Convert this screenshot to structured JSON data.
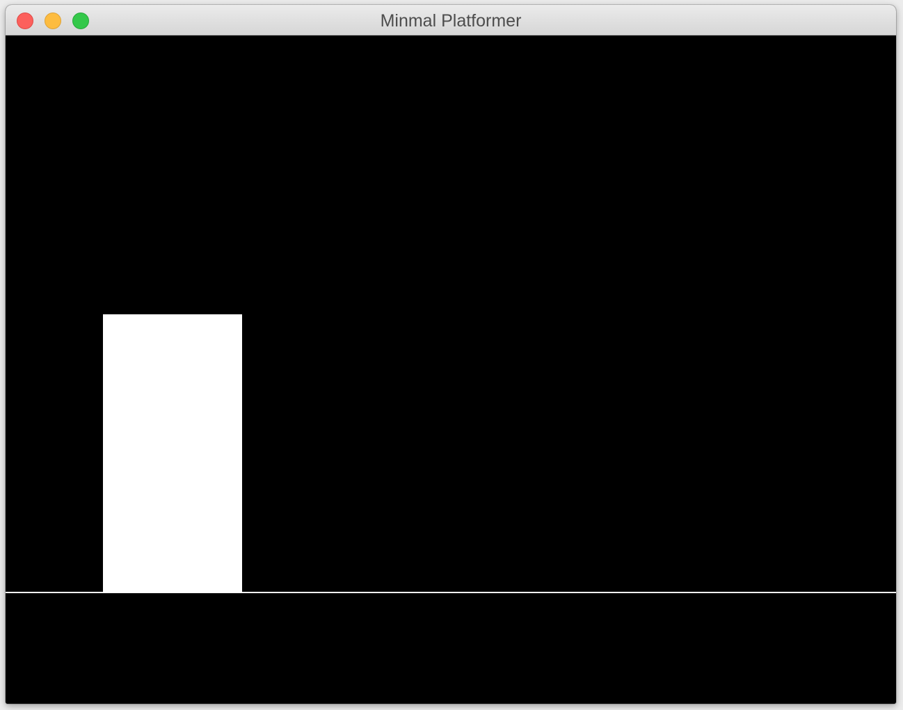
{
  "window": {
    "title": "Minmal Platformer",
    "controls": {
      "close_color": "#fc605c",
      "minimize_color": "#fdbc40",
      "maximize_color": "#34c84a"
    }
  },
  "game": {
    "background_color": "#000000",
    "player": {
      "shape": "rectangle",
      "color": "#ffffff"
    },
    "ground": {
      "shape": "line",
      "color": "#ffffff"
    }
  }
}
